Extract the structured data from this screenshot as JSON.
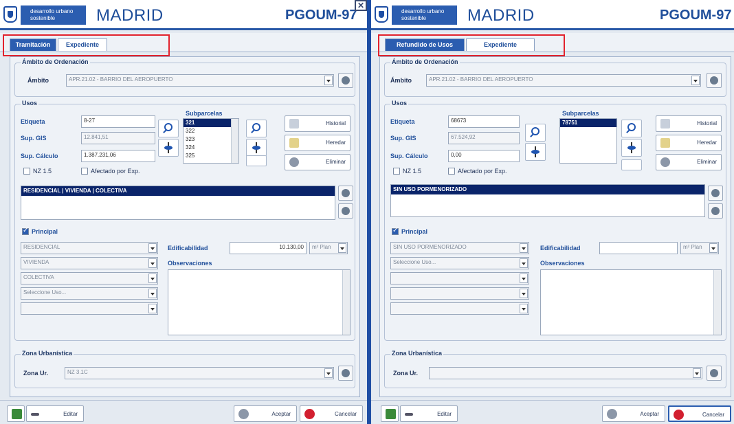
{
  "panels": [
    {
      "brand": {
        "line1": "desarrollo urbano",
        "line2": "sostenible",
        "city": "MADRID",
        "plan": "PGOUM-97"
      },
      "tabs": [
        "Tramitación",
        "Expediente"
      ],
      "ambito_section": {
        "legend": "Ámbito de Ordenación",
        "label": "Ámbito",
        "value": "APR.21.02 - BARRIO DEL AEROPUERTO"
      },
      "usos": {
        "legend": "Usos",
        "etiqueta_label": "Etiqueta",
        "etiqueta_value": "8-27",
        "sup_gis_label": "Sup. GIS",
        "sup_gis_value": "12.841,51",
        "sup_calculo_label": "Sup. Cálculo",
        "sup_calculo_value": "1.387.231,06",
        "nz_label": "NZ 1.5",
        "afectado_label": "Afectado por Exp.",
        "subparcelas_label": "Subparcelas",
        "subparcelas": [
          "321",
          "322",
          "323",
          "324",
          "325"
        ],
        "btn_historial": "Historial",
        "btn_heredar": "Heredar",
        "btn_eliminar": "Eliminar",
        "uso_selected": "RESIDENCIAL | VIVIENDA | COLECTIVA",
        "principal_label": "Principal",
        "combos": [
          "RESIDENCIAL",
          "VIVIENDA",
          "COLECTIVA",
          "Seleccione Uso...",
          ""
        ],
        "edificabilidad_label": "Edificabilidad",
        "edificabilidad_value": "10.130,00",
        "unit": "m² Plan",
        "observaciones_label": "Observaciones"
      },
      "zona": {
        "legend": "Zona Urbanística",
        "label": "Zona Ur.",
        "value": "NZ 3.1C"
      },
      "footer": {
        "editar": "Editar",
        "aceptar": "Aceptar",
        "cancelar": "Cancelar"
      }
    },
    {
      "brand": {
        "line1": "desarrollo urbano",
        "line2": "sostenible",
        "city": "MADRID",
        "plan": "PGOUM-97"
      },
      "tabs": [
        "Refundido de Usos",
        "Expediente"
      ],
      "ambito_section": {
        "legend": "Ámbito de Ordenación",
        "label": "Ámbito",
        "value": "APR.21.02 - BARRIO DEL AEROPUERTO"
      },
      "usos": {
        "legend": "Usos",
        "etiqueta_label": "Etiqueta",
        "etiqueta_value": "68673",
        "sup_gis_label": "Sup. GIS",
        "sup_gis_value": "67.524,92",
        "sup_calculo_label": "Sup. Cálculo",
        "sup_calculo_value": "0,00",
        "nz_label": "NZ 1.5",
        "afectado_label": "Afectado por Exp.",
        "subparcelas_label": "Subparcelas",
        "subparcelas": [
          "78751"
        ],
        "btn_historial": "Historial",
        "btn_heredar": "Heredar",
        "btn_eliminar": "Eliminar",
        "uso_selected": "SIN USO PORMENORIZADO",
        "principal_label": "Principal",
        "combos": [
          "SIN USO PORMENORIZADO",
          "Seleccione Uso...",
          "",
          "",
          ""
        ],
        "edificabilidad_label": "Edificabilidad",
        "edificabilidad_value": "",
        "unit": "m² Plan",
        "observaciones_label": "Observaciones"
      },
      "zona": {
        "legend": "Zona Urbanística",
        "label": "Zona Ur.",
        "value": ""
      },
      "footer": {
        "editar": "Editar",
        "aceptar": "Aceptar",
        "cancelar": "Cancelar"
      }
    }
  ],
  "colors": {
    "brand_blue": "#2b5db0",
    "selection_navy": "#0a246a",
    "highlight_red": "#e2222d"
  }
}
